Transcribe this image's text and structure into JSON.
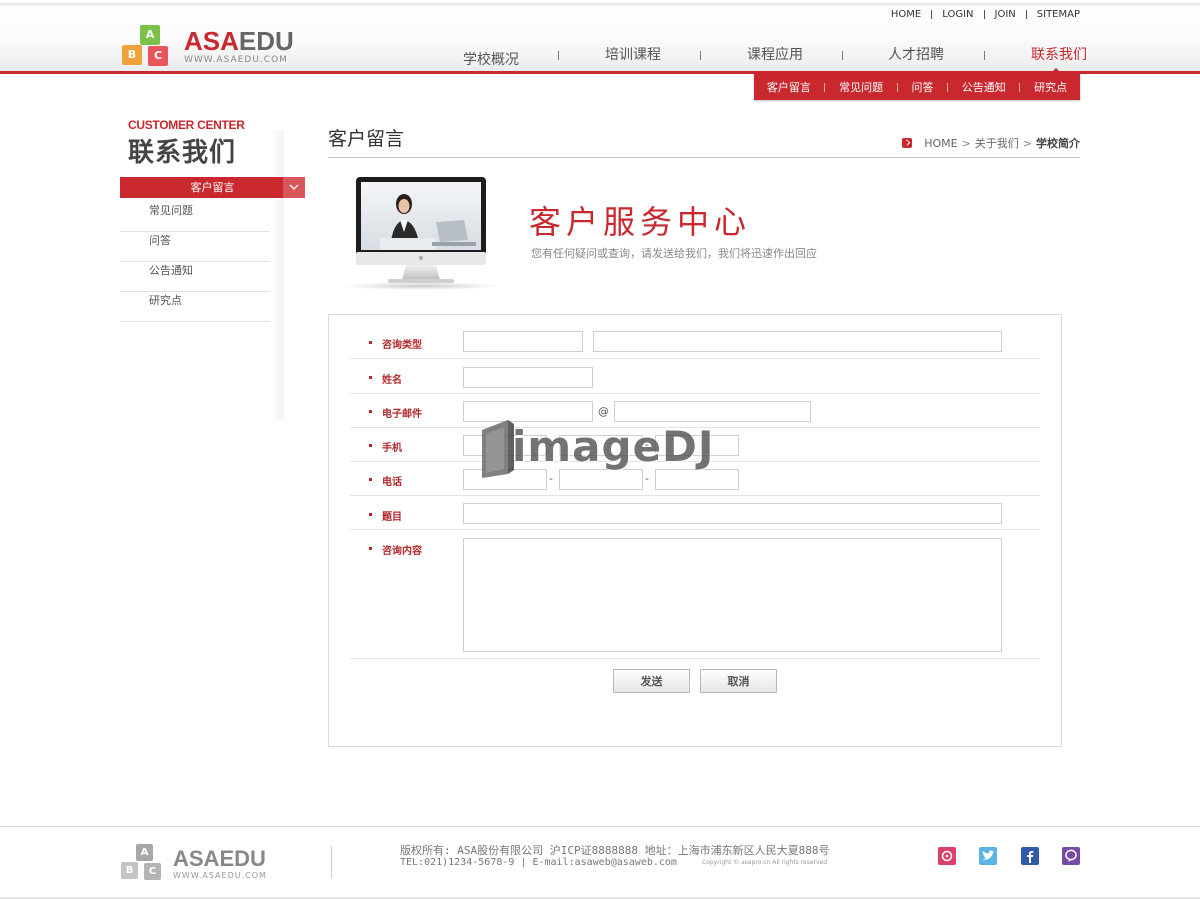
{
  "brand": {
    "logo_main_prefix": "ASA",
    "logo_main_suffix": "EDU",
    "logo_sub": "WWW.ASAEDU.COM",
    "cube_letters": [
      "A",
      "B",
      "C"
    ]
  },
  "top_links": [
    "HOME",
    "LOGIN",
    "JOIN",
    "SITEMAP"
  ],
  "main_nav": [
    "学校概况",
    "培训课程",
    "课程应用",
    "人才招聘",
    "联系我们"
  ],
  "sub_nav": [
    "客户留言",
    "常见问题",
    "问答",
    "公告通知",
    "研究点"
  ],
  "sidebar": {
    "title_en": "CUSTOMER CENTER",
    "title_cn": "联系我们",
    "active": "客户留言",
    "items": [
      "常见问题",
      "问答",
      "公告通知",
      "研究点"
    ]
  },
  "content": {
    "title": "客户留言",
    "breadcrumb": [
      "HOME",
      "关于我们",
      "学校简介"
    ]
  },
  "banner": {
    "title": "客户服务中心",
    "subtitle": "您有任何疑问或查询，请发送给我们，我们将迅速作出回应"
  },
  "form": {
    "labels": {
      "type": "咨询类型",
      "name": "姓名",
      "email": "电子邮件",
      "mobile": "手机",
      "phone": "电话",
      "subject": "题目",
      "content": "咨询内容"
    },
    "at_sign": "@",
    "dash": "-",
    "submit": "发送",
    "cancel": "取消"
  },
  "watermark": "imageDJ",
  "footer": {
    "logo_main": "ASAEDU",
    "logo_sub": "WWW.ASAEDU.COM",
    "line1": "版权所有: ASA股份有限公司 沪ICP证8888888 地址：上海市浦东新区人民大夏888号",
    "line2": "TEL:021)1234-5678-9 | E-mail:asaweb@asaweb.com",
    "copyright": "Copyright © asapro.cn All rights reserved"
  },
  "colors": {
    "accent": "#c8282e",
    "social": [
      "#d9416a",
      "#5bb5e4",
      "#2f5aa8",
      "#7a4aa8"
    ]
  }
}
